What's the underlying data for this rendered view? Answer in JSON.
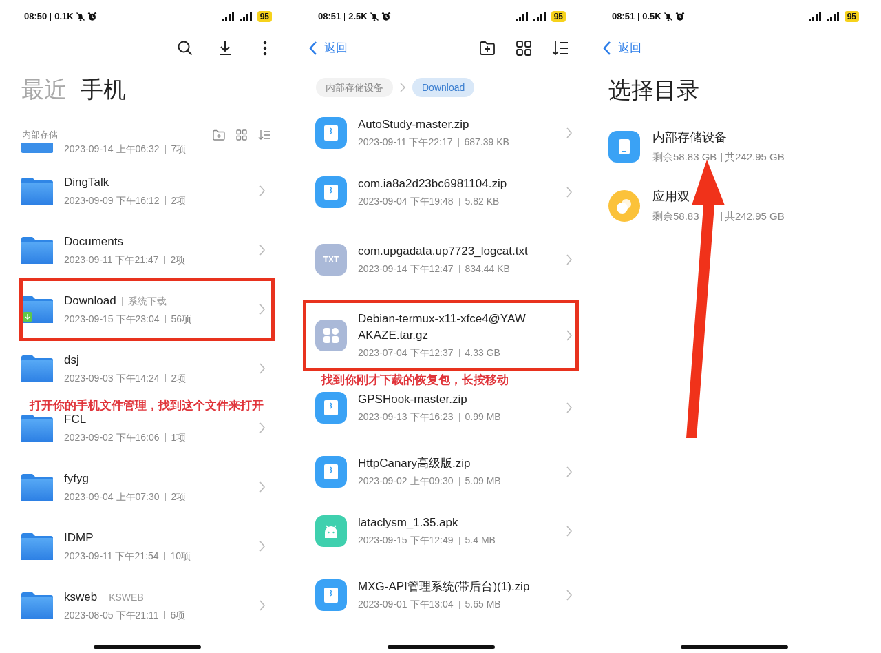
{
  "left_screen": {
    "status_bar": {
      "time": "08:50",
      "speed": "0.1K",
      "battery": "95"
    },
    "tabs": [
      {
        "label": "最近",
        "selected": false
      },
      {
        "label": "手机",
        "selected": true
      }
    ],
    "section_title": "内部存储",
    "partial_row": {
      "date": "2023-09-14 上午06:32",
      "info": "7项"
    },
    "folders": [
      {
        "kind": "folder",
        "name": "DingTalk",
        "date": "2023-09-09 下午16:12",
        "info": "2项",
        "highlighted": false
      },
      {
        "kind": "folder",
        "name": "Documents",
        "date": "2023-09-11 下午21:47",
        "info": "2项",
        "highlighted": false
      },
      {
        "kind": "download",
        "name": "Download",
        "tag": "系统下载",
        "date": "2023-09-15 下午23:04",
        "info": "56项",
        "highlighted": true
      },
      {
        "kind": "folder",
        "name": "dsj",
        "date": "2023-09-03 下午14:24",
        "info": "2项",
        "highlighted": false
      },
      {
        "kind": "folder",
        "name": "FCL",
        "date": "2023-09-02 下午16:06",
        "info": "1项",
        "highlighted": false
      },
      {
        "kind": "folder",
        "name": "fyfyg",
        "date": "2023-09-04 上午07:30",
        "info": "2项",
        "highlighted": false
      },
      {
        "kind": "folder",
        "name": "IDMP",
        "date": "2023-09-11 下午21:54",
        "info": "10项",
        "highlighted": false
      },
      {
        "kind": "folder",
        "name": "ksweb",
        "tag": "KSWEB",
        "date": "2023-08-05 下午21:11",
        "info": "6项",
        "highlighted": false
      }
    ],
    "annotation": "打开你的手机文件管理，找到这个文件来打开"
  },
  "middle_screen": {
    "status_bar": {
      "time": "08:51",
      "speed": "2.5K",
      "battery": "95"
    },
    "back_label": "返回",
    "breadcrumbs": [
      {
        "label": "内部存储设备",
        "selected": false
      },
      {
        "label": "Download",
        "selected": true
      }
    ],
    "files": [
      {
        "kind": "zip",
        "name": "AutoStudy-master.zip",
        "date": "2023-09-11 下午22:17",
        "size": "687.39 KB",
        "highlighted": false
      },
      {
        "kind": "zip",
        "name": "com.ia8a2d23bc6981104.zip",
        "date": "2023-09-04 下午19:48",
        "size": "5.82 KB",
        "highlighted": false
      },
      {
        "kind": "txt",
        "icon_label": "TXT",
        "name": "com.upgadata.up7723_logcat.txt",
        "date": "2023-09-14 下午12:47",
        "size": "834.44 KB",
        "highlighted": false
      },
      {
        "kind": "archive",
        "name": "Debian-termux-x11-xfce4@YAWAKAZE.tar.gz",
        "date": "2023-07-04 下午12:37",
        "size": "4.33 GB",
        "highlighted": true
      },
      {
        "kind": "zip",
        "name": "GPSHook-master.zip",
        "date": "2023-09-13 下午16:23",
        "size": "0.99 MB",
        "highlighted": false
      },
      {
        "kind": "zip",
        "name": "HttpCanary高级版.zip",
        "date": "2023-09-02 上午09:30",
        "size": "5.09 MB",
        "highlighted": false
      },
      {
        "kind": "apk",
        "name": "lataclysm_1.35.apk",
        "date": "2023-09-15 下午12:49",
        "size": "5.4 MB",
        "highlighted": false
      },
      {
        "kind": "zip",
        "name": "MXG-API管理系统(带后台)(1).zip",
        "date": "2023-09-01 下午13:04",
        "size": "5.65 MB",
        "highlighted": false
      }
    ],
    "annotation": "找到你刚才下载的恢复包，长按移动"
  },
  "right_screen": {
    "status_bar": {
      "time": "08:51",
      "speed": "0.5K",
      "battery": "95"
    },
    "back_label": "返回",
    "title": "选择目录",
    "locations": [
      {
        "kind": "phone",
        "name": "内部存储设备",
        "free": "剩余58.83 GB",
        "total": "共242.95 GB"
      },
      {
        "kind": "dual_app",
        "name": "应用双",
        "free": "剩余58.83",
        "total": "共242.95 GB"
      }
    ]
  }
}
